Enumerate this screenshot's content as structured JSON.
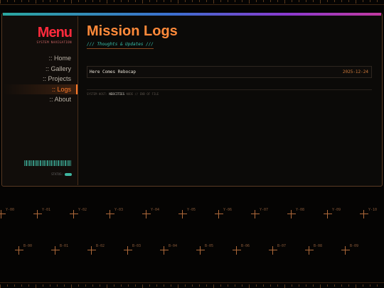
{
  "sidebar": {
    "title": "Menu",
    "subtitle": "SYSTEM NAVIGATION",
    "items": [
      {
        "label": ":: Home"
      },
      {
        "label": ":: Gallery"
      },
      {
        "label": ":: Projects"
      },
      {
        "label": ":: Logs"
      },
      {
        "label": ":: About"
      }
    ],
    "status_label": "STATUS:"
  },
  "main": {
    "title": "Mission Logs",
    "subtitle": "/// Thoughts & Updates ///",
    "logs": [
      {
        "title": "Here Comes Rebocap",
        "date": "2025-12-24"
      }
    ],
    "footer_prefix": "SYSTEM HOST:",
    "footer_host": "NEOCITIES",
    "footer_suffix": "NODE // END OF FILE"
  },
  "grid": {
    "row1": [
      "Y-00",
      "Y-01",
      "Y-02",
      "Y-03",
      "Y-04",
      "Y-05",
      "Y-06",
      "Y-07",
      "Y-08",
      "Y-09",
      "Y-10"
    ],
    "row2": [
      "B-00",
      "B-01",
      "B-02",
      "B-03",
      "B-04",
      "B-05",
      "B-06",
      "B-07",
      "B-08",
      "B-09"
    ]
  },
  "colors": {
    "accent_orange": "#ff8a3a",
    "menu_red": "#ff2a3c",
    "teal": "#38c4ae"
  }
}
